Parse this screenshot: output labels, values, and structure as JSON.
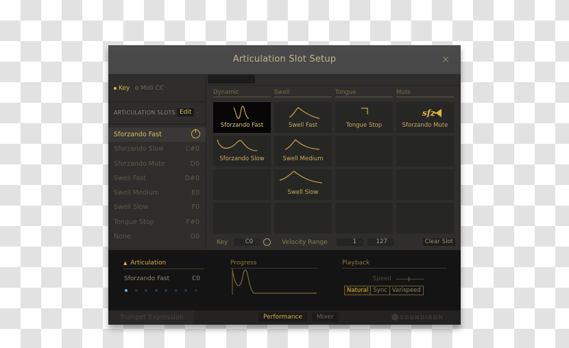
{
  "window": {
    "title": "Articulation Slot Setup",
    "close_icon": "×"
  },
  "mode": {
    "key_label": "Key",
    "midicc_label": "Midi CC",
    "selected": "Key"
  },
  "slots_header": {
    "label": "ARTICULATION SLOTS",
    "edit_label": "Edit"
  },
  "slots": [
    {
      "name": "Sforzando Fast",
      "key": "",
      "selected": true
    },
    {
      "name": "Sforzando Slow",
      "key": "C#0"
    },
    {
      "name": "Sforzando Mute",
      "key": "D0"
    },
    {
      "name": "Swell Fast",
      "key": "D#0"
    },
    {
      "name": "Swell Medium",
      "key": "E0"
    },
    {
      "name": "Swell Slow",
      "key": "F0"
    },
    {
      "name": "Tongue Stop",
      "key": "F#0"
    },
    {
      "name": "None",
      "key": "G0"
    }
  ],
  "categories": [
    "Dynamic",
    "Swell",
    "Tongue",
    "Mute"
  ],
  "grid": [
    {
      "label": "Sforzando Fast",
      "icon": "sforzando-fast-curve",
      "selected": true
    },
    {
      "label": "Swell Fast",
      "icon": "swell-fast-curve"
    },
    {
      "label": "Tongue Stop",
      "icon": "tongue-stop-curve"
    },
    {
      "label": "Sforzando Mute",
      "icon": "sfz-mute",
      "sfz_text": "sfz"
    },
    {
      "label": "Sforzando Slow",
      "icon": "sforzando-slow-curve"
    },
    {
      "label": "Swell Medium",
      "icon": "swell-medium-curve"
    },
    {
      "label": "",
      "icon": ""
    },
    {
      "label": "",
      "icon": ""
    },
    {
      "label": "",
      "icon": ""
    },
    {
      "label": "Swell Slow",
      "icon": "swell-slow-curve"
    },
    {
      "label": "",
      "icon": ""
    },
    {
      "label": "",
      "icon": ""
    },
    {
      "label": "",
      "icon": ""
    },
    {
      "label": "",
      "icon": ""
    },
    {
      "label": "",
      "icon": ""
    },
    {
      "label": "",
      "icon": ""
    }
  ],
  "controls": {
    "key_label": "Key",
    "key_value": "C0",
    "velocity_label": "Velocity Range",
    "vel_min": "1",
    "vel_max": "127",
    "clear_label": "Clear Slot"
  },
  "bottom": {
    "articulation_label": "Articulation",
    "current_name": "Sforzando Fast",
    "current_key": "C0",
    "dots_total": 8,
    "dots_active": 1,
    "progress_label": "Progress",
    "playback_label": "Playback",
    "speed_label": "Speed",
    "playback_modes": [
      "Natural",
      "Sync",
      "Varispeed"
    ],
    "playback_selected": "Natural"
  },
  "footer": {
    "instrument": "Trumpet Expression",
    "tabs": [
      "Performance",
      "Mixer"
    ],
    "active_tab": "Performance",
    "brand": "SOUNDIRON"
  },
  "colors": {
    "accent": "#d8b84a",
    "dot_active": "#5eb6e6"
  }
}
